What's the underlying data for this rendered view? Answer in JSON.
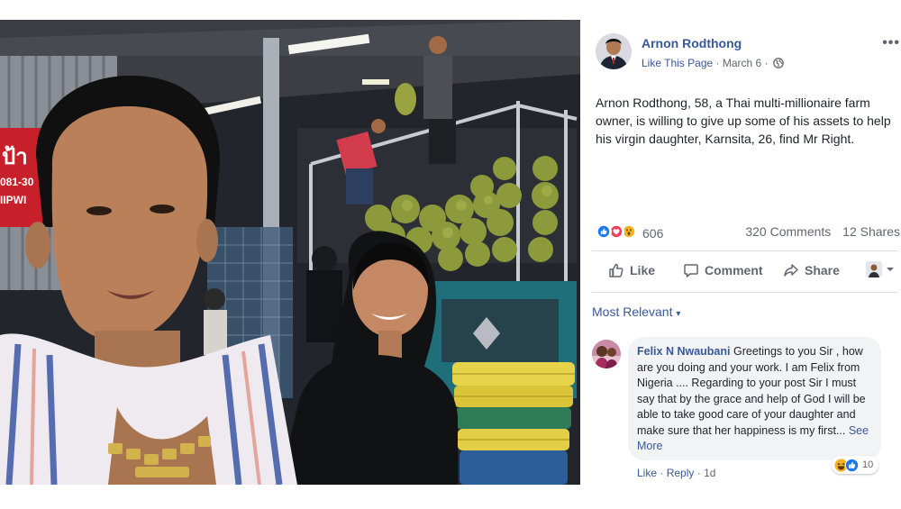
{
  "post": {
    "author": "Arnon Rodthong",
    "like_page": "Like This Page",
    "separator": "·",
    "date": "March 6",
    "more": "•••",
    "text": "Arnon Rodthong, 58, a Thai multi-millionaire farm owner, is willing to give up some of his assets to help his virgin daughter, Karnsita, 26, find Mr Right."
  },
  "stats": {
    "reaction_count": "606",
    "comments": "320 Comments",
    "shares": "12 Shares",
    "reaction_icons": [
      "like-reaction-icon",
      "love-reaction-icon",
      "wow-reaction-icon"
    ]
  },
  "actions": {
    "like": "Like",
    "comment": "Comment",
    "share": "Share"
  },
  "comments_filter": {
    "label": "Most Relevant",
    "caret": "▾"
  },
  "comment": {
    "author": "Felix N Nwaubani",
    "text": "Greetings to you Sir , how are you doing and your work. I am Felix from Nigeria .... Regarding to your post Sir I must say that by the grace and help of God I will be able to take good care of your daughter and make sure that her happiness is my first...",
    "see_more": "See More",
    "like": "Like",
    "dot": "·",
    "reply": "Reply",
    "age": "1d",
    "reaction_count": "10"
  },
  "photo_sign": {
    "top": "ป้า",
    "number": "081-30",
    "bottom": "IIPWI"
  },
  "colors": {
    "link": "#385898",
    "secondary_text": "#606770",
    "bubble": "#f2f3f5",
    "like_blue": "#1877f2",
    "love_red": "#f33e58",
    "wow_yellow": "#f7b125"
  }
}
